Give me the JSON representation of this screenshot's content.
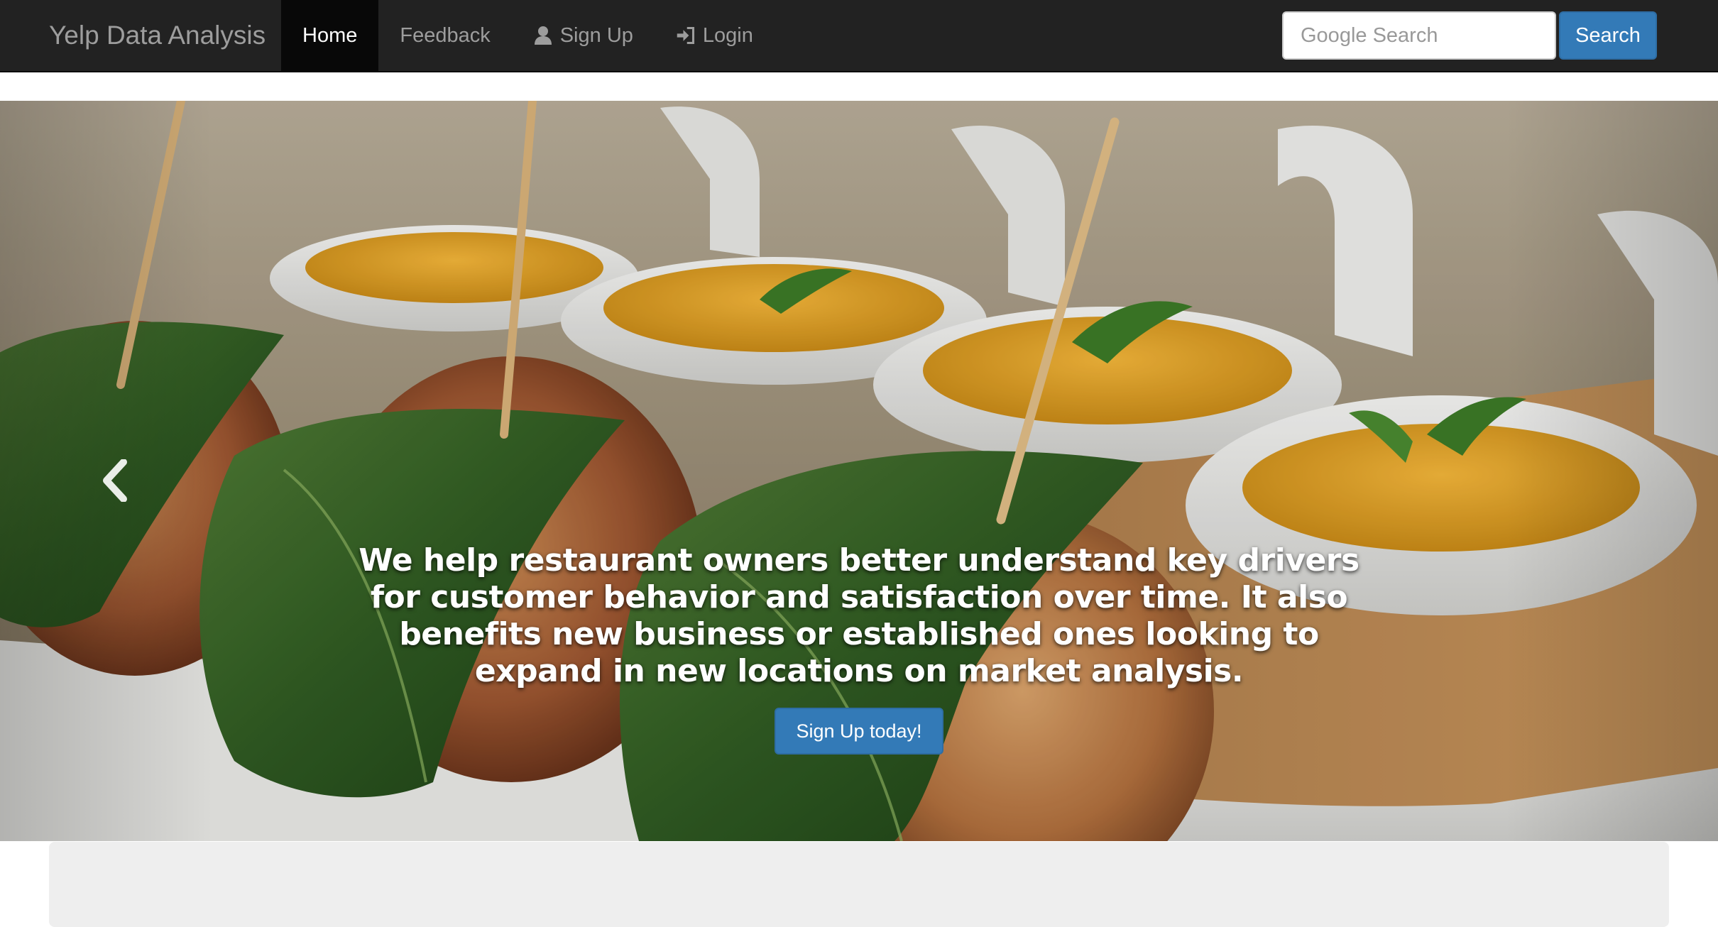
{
  "navbar": {
    "brand": "Yelp Data Analysis",
    "items": [
      {
        "label": "Home",
        "active": true
      },
      {
        "label": "Feedback",
        "active": false
      },
      {
        "label": "Sign Up",
        "icon": "user-icon",
        "active": false
      },
      {
        "label": "Login",
        "icon": "login-icon",
        "active": false
      }
    ],
    "search": {
      "placeholder": "Google Search",
      "value": "",
      "button_label": "Search"
    }
  },
  "carousel": {
    "caption": "We help restaurant owners better understand key drivers for customer behavior and satisfaction over time. It also benefits new business or established ones looking to expand in new locations on market analysis.",
    "cta_label": "Sign Up today!",
    "slide_count": 4,
    "active_slide": 2,
    "prev_icon": "chevron-left-icon",
    "next_icon": "chevron-right-icon"
  },
  "colors": {
    "navbar_bg": "#222222",
    "navbar_active_bg": "#080808",
    "nav_text": "#9d9d9d",
    "primary": "#337ab7",
    "card_bg": "#eeeeee"
  }
}
